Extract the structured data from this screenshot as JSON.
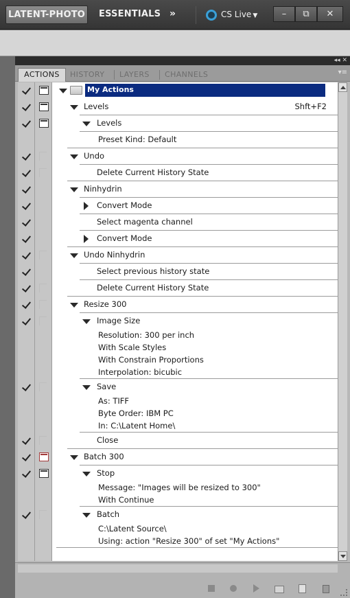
{
  "appbar": {
    "workspace_active": "LATENT-PHOTO",
    "workspace_other": "ESSENTIALS",
    "more": "»",
    "cslive": "CS Live",
    "min": "–",
    "restore": "⧉",
    "close": "✕"
  },
  "panel": {
    "tabs": [
      "ACTIONS",
      "HISTORY",
      "LAYERS",
      "CHANNELS"
    ],
    "menu": "▾≡",
    "rows": [
      {
        "check": true,
        "dialog": "on",
        "level": 0,
        "toggle": "down",
        "text": "My Actions",
        "selected": true
      },
      {
        "check": true,
        "dialog": "on",
        "level": 1,
        "toggle": "down",
        "text": "Levels",
        "shortcut": "Shft+F2"
      },
      {
        "check": true,
        "dialog": "on",
        "level": 2,
        "toggle": "down",
        "text": "Levels"
      },
      {
        "check": false,
        "dialog": "none",
        "level": 3,
        "toggle": "none",
        "text": "Preset Kind: Default",
        "noline": true
      },
      {
        "check": true,
        "dialog": "empty",
        "level": 1,
        "toggle": "down",
        "text": "Undo"
      },
      {
        "check": true,
        "dialog": "empty",
        "level": 2,
        "toggle": "none",
        "text": "Delete Current History State"
      },
      {
        "check": true,
        "dialog": "none",
        "level": 1,
        "toggle": "down",
        "text": "Ninhydrin"
      },
      {
        "check": true,
        "dialog": "none",
        "level": 2,
        "toggle": "right",
        "text": "Convert Mode"
      },
      {
        "check": true,
        "dialog": "none",
        "level": 2,
        "toggle": "none",
        "text": "Select magenta channel"
      },
      {
        "check": true,
        "dialog": "none",
        "level": 2,
        "toggle": "right",
        "text": "Convert Mode"
      },
      {
        "check": true,
        "dialog": "empty",
        "level": 1,
        "toggle": "down",
        "text": "Undo Ninhydrin"
      },
      {
        "check": true,
        "dialog": "none",
        "level": 2,
        "toggle": "none",
        "text": "Select previous history state"
      },
      {
        "check": true,
        "dialog": "empty",
        "level": 2,
        "toggle": "none",
        "text": "Delete Current History State"
      },
      {
        "check": true,
        "dialog": "empty",
        "level": 1,
        "toggle": "down",
        "text": "Resize 300"
      },
      {
        "check": true,
        "dialog": "empty",
        "level": 2,
        "toggle": "down",
        "text": "Image Size"
      },
      {
        "check": false,
        "dialog": "none",
        "level": 3,
        "toggle": "none",
        "text": "Resolution: 300 per inch",
        "noline": true,
        "tight": true
      },
      {
        "check": false,
        "dialog": "none",
        "level": 3,
        "toggle": "none",
        "text": "With Scale Styles",
        "noline": true,
        "tight": true
      },
      {
        "check": false,
        "dialog": "none",
        "level": 3,
        "toggle": "none",
        "text": "With Constrain Proportions",
        "noline": true,
        "tight": true
      },
      {
        "check": false,
        "dialog": "none",
        "level": 3,
        "toggle": "none",
        "text": "Interpolation: bicubic",
        "noline": true,
        "tight": true
      },
      {
        "check": true,
        "dialog": "empty",
        "level": 2,
        "toggle": "down",
        "text": "Save"
      },
      {
        "check": false,
        "dialog": "none",
        "level": 3,
        "toggle": "none",
        "text": "As: TIFF",
        "noline": true,
        "tight": true
      },
      {
        "check": false,
        "dialog": "none",
        "level": 3,
        "toggle": "none",
        "text": "Byte Order: IBM PC",
        "noline": true,
        "tight": true
      },
      {
        "check": false,
        "dialog": "none",
        "level": 3,
        "toggle": "none",
        "text": "In: C:\\Latent Home\\",
        "noline": true,
        "tight": true
      },
      {
        "check": true,
        "dialog": "empty",
        "level": 2,
        "toggle": "none",
        "text": "Close"
      },
      {
        "check": true,
        "dialog": "red",
        "level": 1,
        "toggle": "down",
        "text": "Batch 300"
      },
      {
        "check": true,
        "dialog": "on",
        "level": 2,
        "toggle": "down",
        "text": "Stop"
      },
      {
        "check": false,
        "dialog": "none",
        "level": 3,
        "toggle": "none",
        "text": "Message:  \"Images will be resized to 300\"",
        "noline": true,
        "tight": true
      },
      {
        "check": false,
        "dialog": "none",
        "level": 3,
        "toggle": "none",
        "text": "With Continue",
        "noline": true,
        "tight": true
      },
      {
        "check": true,
        "dialog": "empty",
        "level": 2,
        "toggle": "down",
        "text": "Batch"
      },
      {
        "check": false,
        "dialog": "none",
        "level": 3,
        "toggle": "none",
        "text": "C:\\Latent Source\\",
        "noline": true,
        "tight": true
      },
      {
        "check": false,
        "dialog": "none",
        "level": 3,
        "toggle": "none",
        "text": "Using: action \"Resize 300\" of set \"My Actions\"",
        "noline": true,
        "tight": true
      }
    ]
  },
  "colors": {
    "selection": "#0b2b80",
    "gutter": "#c6c6c6",
    "panel_bg": "#b8b8b8"
  }
}
